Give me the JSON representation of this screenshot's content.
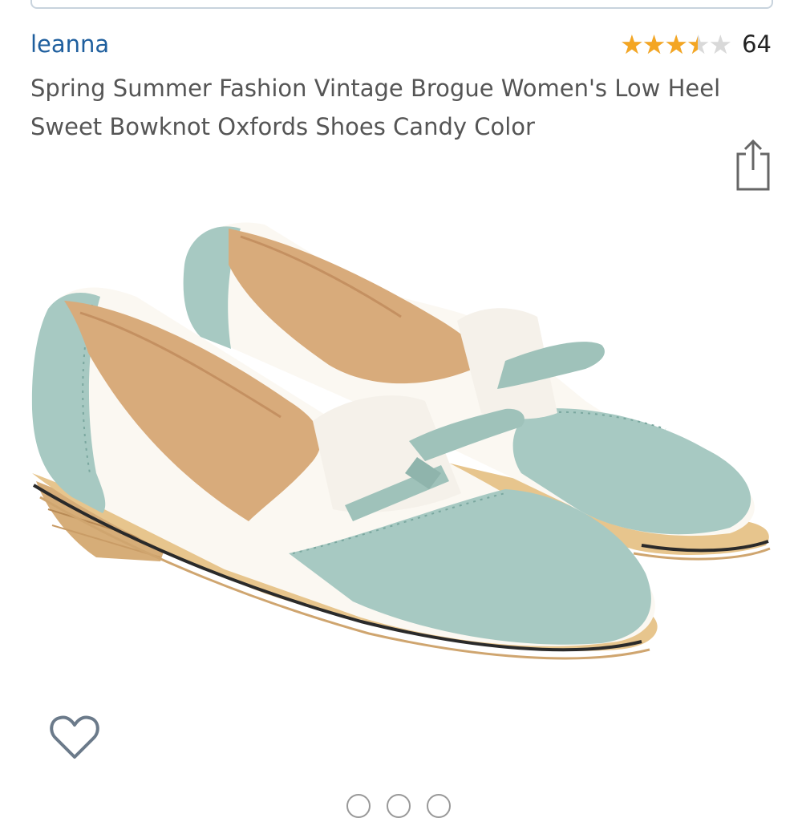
{
  "brand": {
    "name": "leanna"
  },
  "rating": {
    "stars_glyphs": "★★★★★",
    "value": 3.5,
    "count": "64"
  },
  "product": {
    "title": "Spring Summer Fashion Vintage Brogue Women's Low Heel Sweet Bowknot Oxfords Shoes Candy Color"
  },
  "icons": {
    "share": "share-icon",
    "wishlist": "heart-outline-icon"
  },
  "image": {
    "description_label": "",
    "colors": {
      "mint": "#a7c9c2",
      "white": "#fbf8f2",
      "tan": "#d2a06a",
      "sole": "#e7c58d"
    }
  },
  "carousel": {
    "dots": 3
  },
  "colors": {
    "brand_link": "#1f5f9e",
    "star_filled": "#f4a623",
    "star_empty": "#d9d9d9",
    "title_text": "#555555"
  }
}
